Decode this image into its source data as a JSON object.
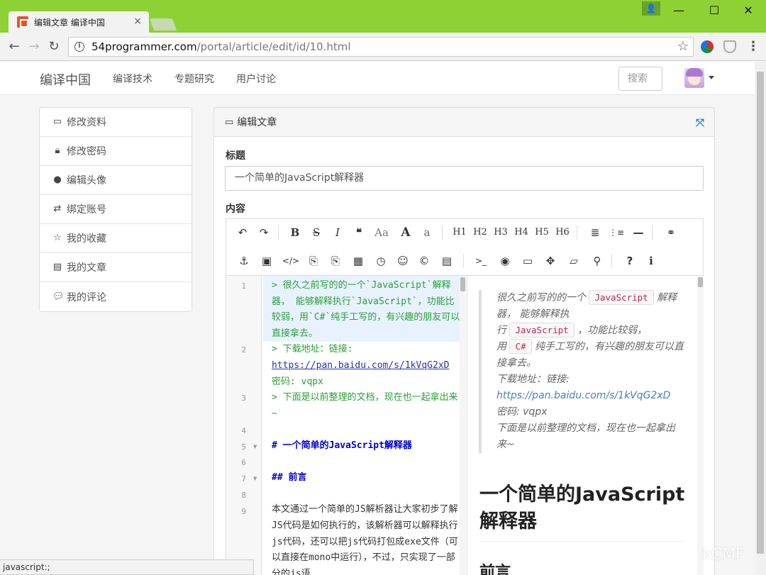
{
  "browser": {
    "tab_title": "编辑文章 编译中国",
    "tab_close": "×",
    "window_buttons": {
      "minimize": "—",
      "maximize": "☐",
      "close": "✕"
    },
    "url_host": "54programmer.com",
    "url_path": "/portal/article/edit/id/10.html",
    "status_text": "javascript:;",
    "accent_color": "#8ed135"
  },
  "site_nav": {
    "brand": "编译中国",
    "items": [
      {
        "label": "编译技术"
      },
      {
        "label": "专题研究"
      },
      {
        "label": "用户讨论"
      }
    ],
    "search_placeholder": "搜索"
  },
  "sidebar": {
    "items": [
      {
        "label": "修改资料",
        "icon": "id-card-icon"
      },
      {
        "label": "修改密码",
        "icon": "lock-icon"
      },
      {
        "label": "编辑头像",
        "icon": "user-icon"
      },
      {
        "label": "绑定账号",
        "icon": "exchange-icon"
      },
      {
        "label": "我的收藏",
        "icon": "star-icon"
      },
      {
        "label": "我的文章",
        "icon": "file-icon"
      },
      {
        "label": "我的评论",
        "icon": "comments-icon"
      }
    ]
  },
  "panel": {
    "title": "编辑文章",
    "title_label": "标题",
    "title_value": "一个简单的JavaScript解释器",
    "content_label": "内容"
  },
  "toolbar": {
    "row1": [
      "↶",
      "↷",
      "B",
      "S",
      "I",
      "❝",
      "Aa",
      "A",
      "a",
      "H1",
      "H2",
      "H3",
      "H4",
      "H5",
      "H6",
      "≣",
      "⋮≡",
      "—",
      "⚭"
    ],
    "row2": [
      "⚓",
      "▣",
      "</>",
      "⎘",
      "⎘",
      "▦",
      "◷",
      "☺",
      "©",
      "▤",
      ">_",
      "◉",
      "▭",
      "✥",
      "▱",
      "⚲",
      "?",
      "i"
    ]
  },
  "code": {
    "line_numbers": [
      "1",
      "2",
      "3",
      "4",
      "5",
      "6",
      "7",
      "8",
      "9"
    ],
    "lines": [
      "> 很久之前写的的一个`JavaScript`解释器， 能够解释执行`JavaScript`，功能比较弱，用`C#`纯手工写的，有兴趣的朋友可以直接拿去。",
      "> 下载地址：链接:",
      "https://pan.baidu.com/s/1kVqG2xD",
      "密码: vqpx",
      "> 下面是以前整理的文档，现在也一起拿出来~",
      "# 一个简单的JavaScript解释器",
      "## 前言",
      "本文通过一个简单的JS解析器让大家初步了解JS代码是如何执行的，该解析器可以解释执行js代码，还可以把js代码打包成exe文件（可以直接在mono中运行），不过，只实现了一部分的js语"
    ]
  },
  "preview": {
    "q1": "很久之前写的的一个",
    "q1_code": "JavaScript",
    "q1_b": "解释器， 能够解释执",
    "q1_c": "行",
    "q2_code": "JavaScript",
    "q2_b": "，功能比较弱，",
    "q2_c": "用",
    "q3_code": "C#",
    "q3_b": "纯手工写的，有兴趣的朋友可以直接拿去。",
    "q4": "下载地址：链接:",
    "q4_link": "https://pan.baidu.com/s/1kVqG2xD",
    "q5": "密码: vqpx",
    "q6": "下面是以前整理的文档，现在也一起拿出来~",
    "h1": "一个简单的JavaScript解释器",
    "h2": "前言"
  },
  "watermark": "kCMF"
}
